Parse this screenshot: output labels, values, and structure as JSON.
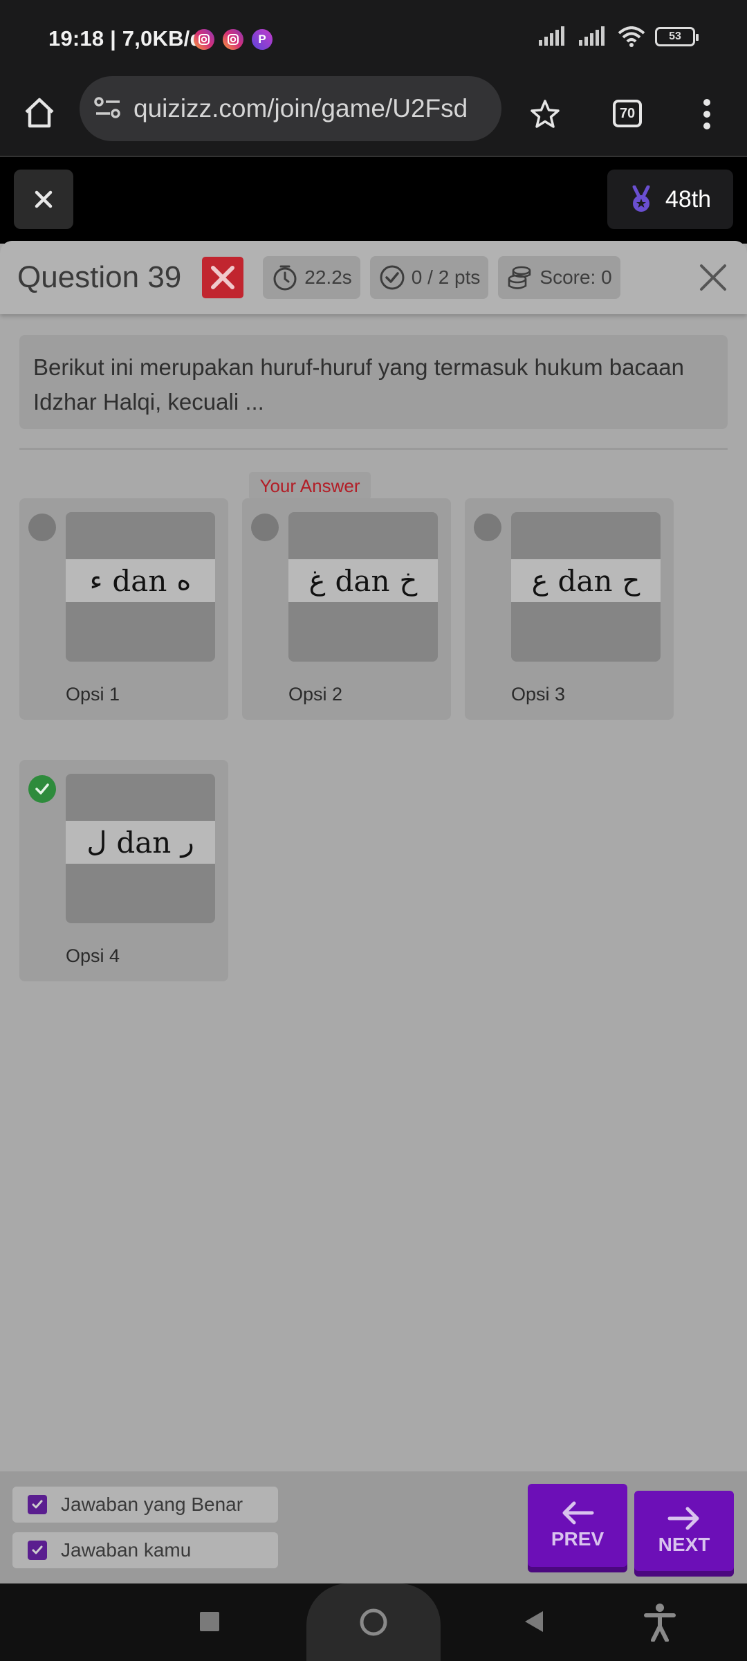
{
  "status_bar": {
    "time_speed": "19:18 | 7,0KB/d",
    "battery": "53",
    "apps": [
      "instagram-icon",
      "instagram-icon",
      "p-app-icon"
    ],
    "p_app_letter": "P"
  },
  "browser": {
    "url": "quizizz.com/join/game/U2Fsd",
    "tab_count": "70"
  },
  "game_header": {
    "rank": "48th"
  },
  "question": {
    "title": "Question 39",
    "time": "22.2s",
    "points": "0 / 2 pts",
    "score": "Score: 0",
    "text": "Berikut ini merupakan huruf-huruf yang termasuk hukum bacaan Idzhar Halqi, kecuali ...",
    "your_answer_label": "Your Answer"
  },
  "options": [
    {
      "label": "Opsi 1",
      "left_letter": "ء",
      "conj": "dan",
      "right_letter": "ه",
      "state": "unselected"
    },
    {
      "label": "Opsi 2",
      "left_letter": "غ",
      "conj": "dan",
      "right_letter": "خ",
      "state": "your-answer"
    },
    {
      "label": "Opsi 3",
      "left_letter": "ع",
      "conj": "dan",
      "right_letter": "ح",
      "state": "unselected"
    },
    {
      "label": "Opsi 4",
      "left_letter": "ل",
      "conj": "dan",
      "right_letter": "ر",
      "state": "correct"
    }
  ],
  "legend": {
    "correct": "Jawaban yang Benar",
    "yours": "Jawaban kamu"
  },
  "nav": {
    "prev": "PREV",
    "next": "NEXT"
  },
  "colors": {
    "accent_purple": "#6c0fb7",
    "wrong_red": "#c1252f",
    "correct_green": "#2e8b3c",
    "your_answer_red": "#b21e27"
  }
}
